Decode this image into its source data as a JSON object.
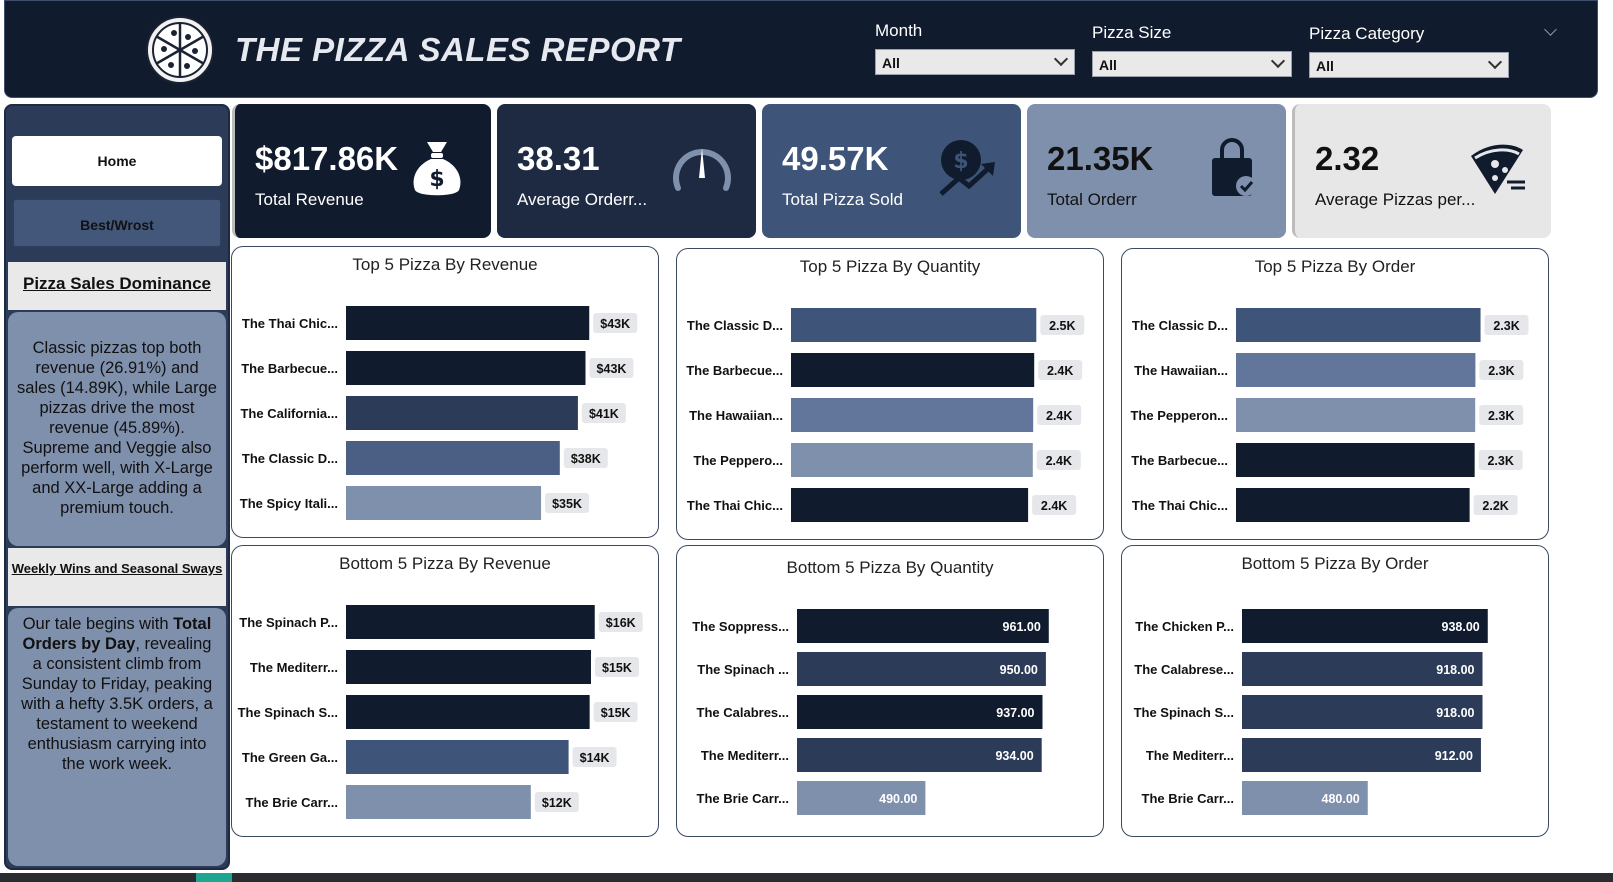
{
  "header": {
    "title": "THE PIZZA SALES REPORT",
    "filters": [
      {
        "label": "Month",
        "value": "All"
      },
      {
        "label": "Pizza Size",
        "value": "All"
      },
      {
        "label": "Pizza Category",
        "value": "All"
      }
    ]
  },
  "sidebar": {
    "nav": [
      {
        "label": "Home"
      },
      {
        "label": "Best/Wrost"
      }
    ],
    "section1": {
      "title": "Pizza Sales Dominance",
      "body": "Classic pizzas top both revenue (26.91%) and sales (14.89K), while Large pizzas drive the most revenue (45.89%). Supreme and Veggie also perform well, with X-Large and XX-Large adding a premium touch."
    },
    "section2": {
      "title": "Weekly Wins and Seasonal Sways",
      "body_pre": "Our tale begins with ",
      "body_bold": "Total Orders by Day",
      "body_post": ", revealing a consistent climb from Sunday to Friday, peaking with a hefty 3.5K orders, a testament to weekend enthusiasm carrying into the work week."
    }
  },
  "kpis": [
    {
      "value": "$817.86K",
      "label": "Total Revenue",
      "icon": "money-bag-icon",
      "bg": "#111b2e",
      "fg": "#ffffff"
    },
    {
      "value": "38.31",
      "label": "Average Orderr...",
      "icon": "gauge-icon",
      "bg": "#1e2a42",
      "fg": "#ffffff"
    },
    {
      "value": "49.57K",
      "label": "Total Pizza Sold",
      "icon": "dollar-growth-icon",
      "bg": "#3e5479",
      "fg": "#ffffff"
    },
    {
      "value": "21.35K",
      "label": "Total Orderr",
      "icon": "shopping-bag-icon",
      "bg": "#7f90ad",
      "fg": "#111111"
    },
    {
      "value": "2.32",
      "label": "Average Pizzas per...",
      "icon": "pizza-slice-icon",
      "bg": "#e7e7e7",
      "fg": "#111111"
    }
  ],
  "colors": {
    "navy_dark": "#111b2e",
    "navy": "#1e2a42",
    "slate": "#3e5479",
    "steel": "#62759a",
    "light_steel": "#7f90ad"
  },
  "chart_data": [
    {
      "type": "bar",
      "title": "Top 5 Pizza By Revenue",
      "categories": [
        "The Thai Chic...",
        "The Barbecue...",
        "The California...",
        "The Classic D...",
        "The Spicy Itali..."
      ],
      "values": [
        43434,
        42768,
        41410,
        38180,
        34831
      ],
      "labels": [
        "$43K",
        "$43K",
        "$41K",
        "$38K",
        "$35K"
      ],
      "colors": [
        "#111b2e",
        "#111b2e",
        "#2b3b58",
        "#4a5f83",
        "#7f90ad"
      ],
      "xlim": [
        0,
        45000
      ]
    },
    {
      "type": "bar",
      "title": "Top 5 Pizza By Quantity",
      "categories": [
        "The Classic D...",
        "The Barbecue...",
        "The Hawaiian...",
        "The Peppero...",
        "The Thai Chic..."
      ],
      "values": [
        2453,
        2432,
        2422,
        2418,
        2371
      ],
      "labels": [
        "2.5K",
        "2.4K",
        "2.4K",
        "2.4K",
        "2.4K"
      ],
      "colors": [
        "#3e5479",
        "#111b2e",
        "#62759a",
        "#7f90ad",
        "#111b2e"
      ],
      "xlim": [
        0,
        2520
      ]
    },
    {
      "type": "bar",
      "title": "Top 5 Pizza By Order",
      "categories": [
        "The Classic D...",
        "The Hawaiian...",
        "The Pepperon...",
        "The Barbecue...",
        "The Thai Chic..."
      ],
      "values": [
        2329,
        2280,
        2278,
        2273,
        2225
      ],
      "labels": [
        "2.3K",
        "2.3K",
        "2.3K",
        "2.3K",
        "2.2K"
      ],
      "colors": [
        "#3e5479",
        "#62759a",
        "#7f90ad",
        "#111b2e",
        "#111b2e"
      ],
      "xlim": [
        0,
        2400
      ]
    },
    {
      "type": "bar",
      "title": "Bottom 5 Pizza By Revenue",
      "categories": [
        "The Spinach P...",
        "The Mediterr...",
        "The Spinach S...",
        "The Green Ga...",
        "The Brie Carr..."
      ],
      "values": [
        15596,
        15360,
        15277,
        13956,
        11588
      ],
      "labels": [
        "$16K",
        "$15K",
        "$15K",
        "$14K",
        "$12K"
      ],
      "colors": [
        "#111b2e",
        "#111b2e",
        "#111b2e",
        "#3e5479",
        "#7f90ad"
      ],
      "xlim": [
        0,
        15800
      ]
    },
    {
      "type": "bar",
      "title": "Bottom 5 Pizza By Quantity",
      "categories": [
        "The Soppress...",
        "The Spinach ...",
        "The Calabres...",
        "The Mediterr...",
        "The Brie Carr..."
      ],
      "values": [
        961,
        950,
        937,
        934,
        490
      ],
      "labels": [
        "961.00",
        "950.00",
        "937.00",
        "934.00",
        "490.00"
      ],
      "colors": [
        "#111b2e",
        "#2b3b58",
        "#111b2e",
        "#2b3b58",
        "#7f90ad"
      ],
      "xlim": [
        0,
        1000
      ],
      "inside_labels": true
    },
    {
      "type": "bar",
      "title": "Bottom 5 Pizza By Order",
      "categories": [
        "The Chicken P...",
        "The Calabrese...",
        "The Spinach S...",
        "The Mediterr...",
        "The Brie Carr..."
      ],
      "values": [
        938,
        918,
        918,
        912,
        480
      ],
      "labels": [
        "938.00",
        "918.00",
        "918.00",
        "912.00",
        "480.00"
      ],
      "colors": [
        "#111b2e",
        "#2b3b58",
        "#2b3b58",
        "#2b3b58",
        "#7f90ad"
      ],
      "xlim": [
        0,
        1000
      ],
      "inside_labels": true
    }
  ]
}
